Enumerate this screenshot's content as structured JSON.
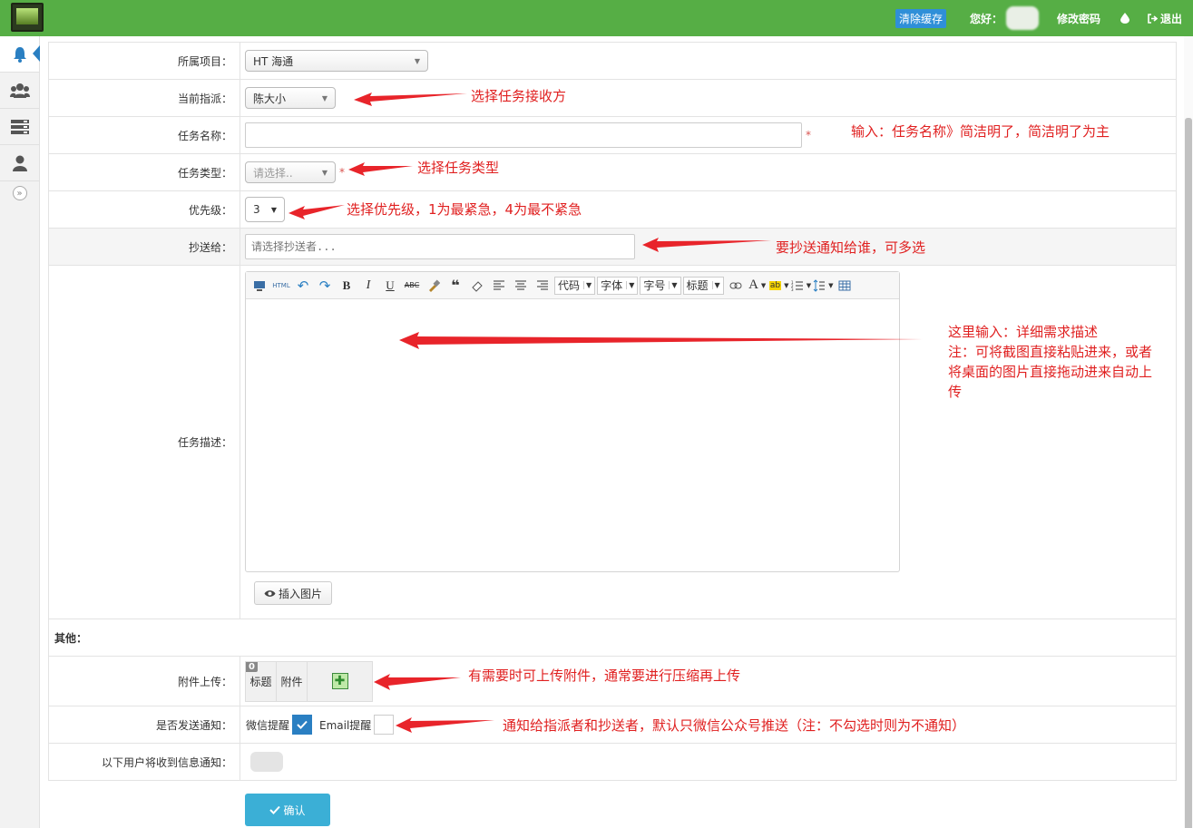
{
  "header": {
    "clear_cache": "清除缓存",
    "hello": "您好：",
    "change_password": "修改密码",
    "logout": "退出"
  },
  "sidebar": {
    "items": [
      "bell-icon",
      "users-icon",
      "list-icon",
      "user-icon"
    ],
    "collapse": "»"
  },
  "form": {
    "project": {
      "label": "所属项目：",
      "value": "HT 海通"
    },
    "assignee": {
      "label": "当前指派：",
      "value": "陈大小"
    },
    "task_name": {
      "label": "任务名称：",
      "value": "",
      "required": "*"
    },
    "task_type": {
      "label": "任务类型：",
      "placeholder": "请选择..",
      "required": "*"
    },
    "priority": {
      "label": "优先级：",
      "value": "3"
    },
    "cc": {
      "label": "抄送给：",
      "placeholder": "请选择抄送者..."
    },
    "description": {
      "label": "任务描述："
    },
    "insert_image": "插入图片",
    "other": "其他：",
    "attachment": {
      "label": "附件上传：",
      "badge": "0",
      "col_title": "标题",
      "col_file": "附件"
    },
    "notify": {
      "label": "是否发送通知：",
      "wechat": "微信提醒",
      "wechat_checked": true,
      "email": "Email提醒",
      "email_checked": false
    },
    "receivers": {
      "label": "以下用户将收到信息通知："
    }
  },
  "toolbar": {
    "code": "代码",
    "font": "字体",
    "size": "字号",
    "heading": "标题",
    "html": "HTML",
    "b": "B",
    "i": "I",
    "u": "U",
    "abc": "ABC",
    "font_color": "A"
  },
  "submit": "确认",
  "annotations": {
    "assignee": "选择任务接收方",
    "task_name": "输入：任务名称》简洁明了，简洁明了为主",
    "task_type": "选择任务类型",
    "priority": "选择优先级，1为最紧急，4为最不紧急",
    "cc": "要抄送通知给谁，可多选",
    "description_1": "这里输入：详细需求描述",
    "description_2": "注：可将截图直接粘贴进来，或者",
    "description_3": "将桌面的图片直接拖动进来自动上",
    "description_4": "传",
    "attachment": "有需要时可上传附件，通常要进行压缩再上传",
    "notify": "通知给指派者和抄送者，默认只微信公众号推送（注：不勾选时则为不通知）"
  },
  "colors": {
    "topbar": "#56ae45",
    "accent": "#2a7fc2",
    "submit": "#3bafd6",
    "annotation": "#e02020"
  }
}
